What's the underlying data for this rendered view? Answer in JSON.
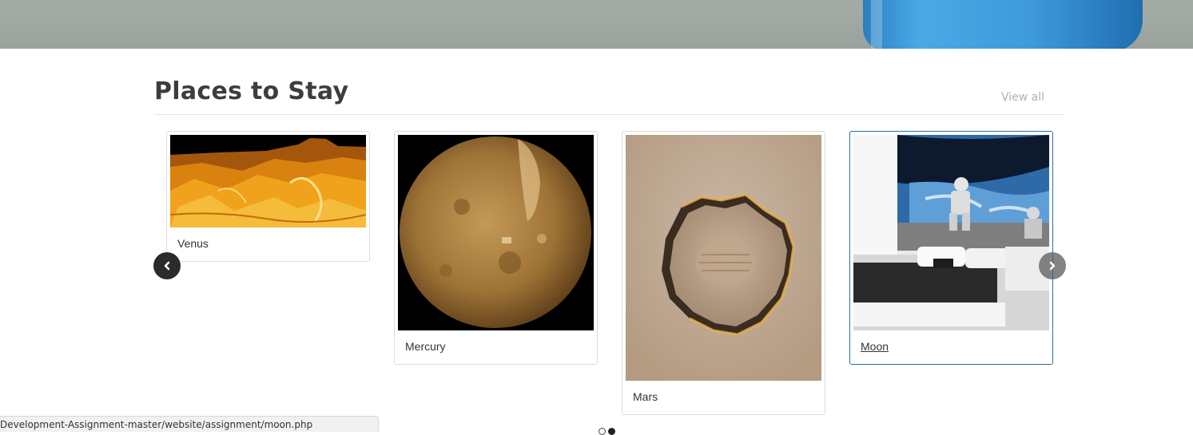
{
  "section": {
    "title": "Places to Stay",
    "view_all_label": "View all"
  },
  "carousel": {
    "cards": [
      {
        "label": "Venus",
        "image": "venus-surface-image"
      },
      {
        "label": "Mercury",
        "image": "mercury-planet-image"
      },
      {
        "label": "Mars",
        "image": "mars-crater-image"
      },
      {
        "label": "Moon",
        "image": "moon-bedroom-astronaut-image",
        "active": true
      }
    ],
    "prev_icon": "chevron-left-icon",
    "next_icon": "chevron-right-icon",
    "indicators": {
      "count": 2,
      "active_index": 1
    }
  },
  "status_bar": {
    "url": "Development-Assignment-master/website/assignment/moon.php"
  },
  "colors": {
    "title": "#3d3d3d",
    "view_all": "#a9b3ba",
    "card_border": "#dcdcdc",
    "active_card_border": "#2f6f9c",
    "arrow_prev_bg": "#2b2b2b"
  }
}
